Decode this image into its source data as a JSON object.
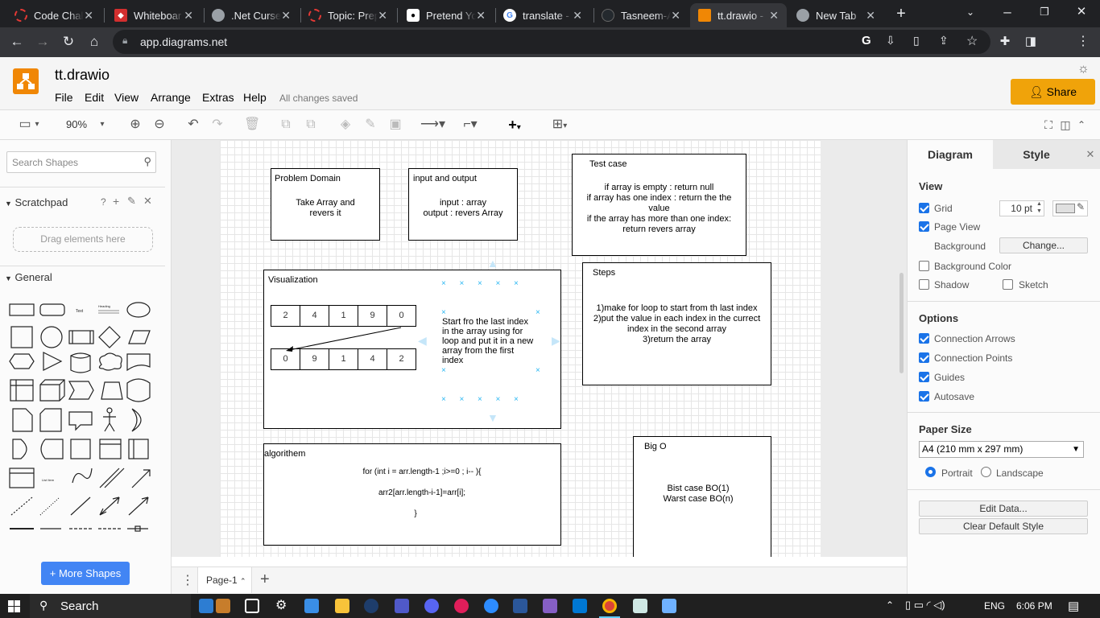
{
  "browser": {
    "tabs": [
      {
        "title": "Code Chall",
        "icon": "ring-icon",
        "color": "#e53935"
      },
      {
        "title": "Whiteboar",
        "icon": "diamond-icon",
        "color": "#d32f2f"
      },
      {
        "title": ".Net Curse",
        "icon": "globe-icon",
        "color": "#9aa0a6"
      },
      {
        "title": "Topic: Prep",
        "icon": "ring-icon",
        "color": "#e53935"
      },
      {
        "title": "Pretend Yo",
        "icon": "medium-icon",
        "color": "#000000"
      },
      {
        "title": "translate -",
        "icon": "google-icon",
        "color": "#4285f4"
      },
      {
        "title": "Tasneem-A",
        "icon": "github-icon",
        "color": "#24292e"
      },
      {
        "title": "tt.drawio -",
        "icon": "drawio-icon",
        "color": "#f08705"
      },
      {
        "title": "New Tab",
        "icon": "globe-icon",
        "color": "#9aa0a6"
      }
    ],
    "url": "app.diagrams.net"
  },
  "app": {
    "title": "tt.drawio",
    "menu": [
      "File",
      "Edit",
      "View",
      "Arrange",
      "Extras",
      "Help"
    ],
    "status": "All changes saved",
    "share_label": "Share"
  },
  "toolbar": {
    "zoom": "90%"
  },
  "sidebar": {
    "search_placeholder": "Search Shapes",
    "scratchpad_label": "Scratchpad",
    "scratchpad_help": "?",
    "drag_hint": "Drag elements here",
    "general_label": "General",
    "more_shapes": "+ More Shapes"
  },
  "diagram": {
    "problem_domain": {
      "title": "Problem Domain",
      "body": "Take Array and\nrevers it"
    },
    "io": {
      "title": "input and output",
      "body": "input : array\noutput : revers Array"
    },
    "test_case": {
      "title": "Test case",
      "body": "if array is empty : return null\nif array has one index : return the the\nvalue\nif the array has more than one index:\nreturn revers array"
    },
    "visualization": {
      "title": "Visualization",
      "row1": [
        "2",
        "4",
        "1",
        "9",
        "0"
      ],
      "row2": [
        "0",
        "9",
        "1",
        "4",
        "2"
      ],
      "note": "Start fro the last index\nin the array using for\nloop and put it in  a new\narray from the first\nindex"
    },
    "steps": {
      "title": "Steps",
      "body": "1)make for loop to start from th last index\n2)put the value in each index in the currect\nindex in the second array\n3)return the array"
    },
    "algorithm": {
      "title": "algorithem",
      "line1": "for  (int i = arr.length-1 ;i>=0 ; i-- ){",
      "line2": "arr2[arr.length-i-1]=arr[i];",
      "line3": "}"
    },
    "big_o": {
      "title": "Big O",
      "body": "Bist case BO(1)\nWarst case BO(n)"
    }
  },
  "pages": {
    "current": "Page-1"
  },
  "panel": {
    "tabs": [
      "Diagram",
      "Style"
    ],
    "view_label": "View",
    "grid_label": "Grid",
    "grid_size": "10 pt",
    "page_view_label": "Page View",
    "background_label": "Background",
    "change_label": "Change...",
    "bg_color_label": "Background Color",
    "shadow_label": "Shadow",
    "sketch_label": "Sketch",
    "options_label": "Options",
    "options": [
      "Connection Arrows",
      "Connection Points",
      "Guides",
      "Autosave"
    ],
    "paper_size_label": "Paper Size",
    "paper_size": "A4 (210 mm x 297 mm)",
    "portrait": "Portrait",
    "landscape": "Landscape",
    "edit_data": "Edit Data...",
    "clear_style": "Clear Default Style"
  },
  "taskbar": {
    "search": "Search",
    "lang": "ENG",
    "time": "6:06 PM"
  }
}
